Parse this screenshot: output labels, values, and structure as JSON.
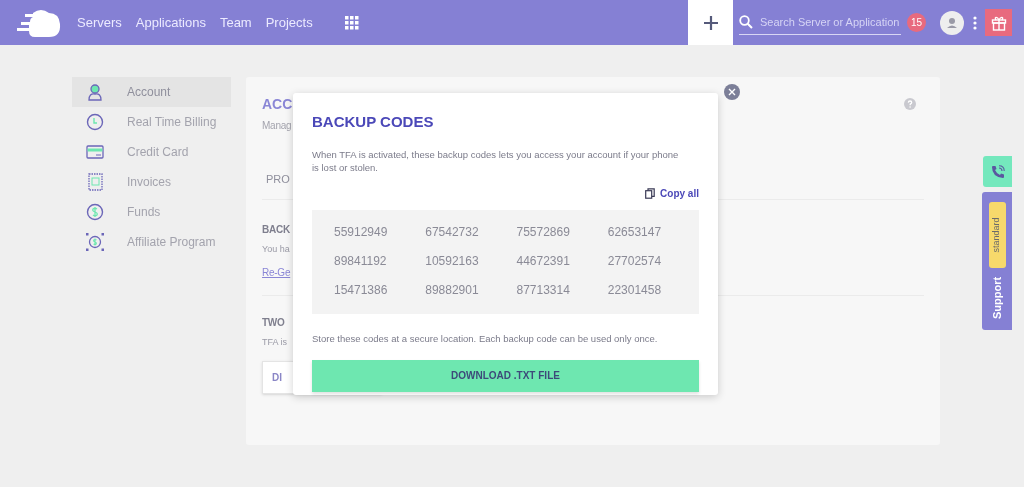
{
  "header": {
    "nav": [
      {
        "label": "Servers"
      },
      {
        "label": "Applications"
      },
      {
        "label": "Team"
      },
      {
        "label": "Projects"
      }
    ],
    "search": {
      "placeholder": "Search Server or Application"
    },
    "notification_count": "15"
  },
  "sidebar": {
    "items": [
      {
        "label": "Account",
        "selected": true
      },
      {
        "label": "Real Time Billing",
        "selected": false
      },
      {
        "label": "Credit Card",
        "selected": false
      },
      {
        "label": "Invoices",
        "selected": false
      },
      {
        "label": "Funds",
        "selected": false
      },
      {
        "label": "Affiliate Program",
        "selected": false
      }
    ]
  },
  "account_card": {
    "title": "ACC",
    "subtitle": "Manag",
    "tab": "PRO",
    "backup_heading": "BACK",
    "backup_text": "You ha",
    "regenerate_link": "Re-Ge",
    "tfa_heading": "TWO",
    "tfa_text": "TFA is",
    "disable_button": "DI"
  },
  "modal": {
    "title": "BACKUP CODES",
    "description": "When TFA is activated, these backup codes lets you access your account if your phone is lost or stolen.",
    "copy_all": "Copy all",
    "codes": [
      "55912949",
      "67542732",
      "75572869",
      "62653147",
      "89841192",
      "10592163",
      "44672391",
      "27702574",
      "15471386",
      "89882901",
      "87713314",
      "22301458"
    ],
    "note": "Store these codes at a secure location. Each backup code can be used only once.",
    "download_button": "DOWNLOAD .TXT FILE"
  },
  "support": {
    "badge": "standard",
    "label": "Support"
  }
}
